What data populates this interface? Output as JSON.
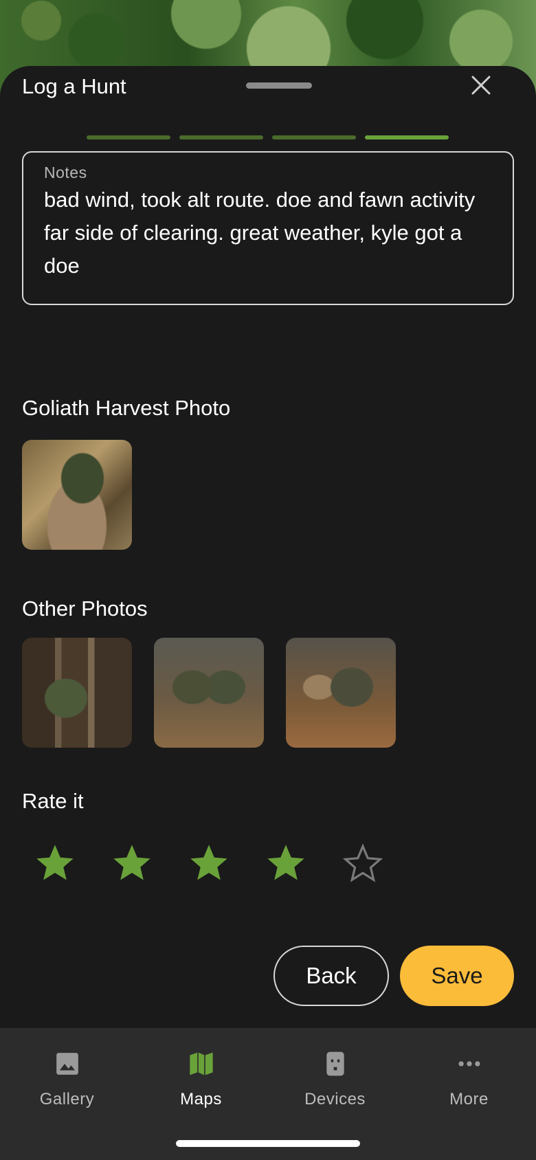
{
  "header": {
    "title": "Log a Hunt",
    "close_icon": "close-icon"
  },
  "progress": {
    "steps": 4,
    "current": 4
  },
  "notes": {
    "label": "Notes",
    "value": "bad wind, took alt route. doe and fawn activity far side of clearing. great weather, kyle got a doe"
  },
  "harvest": {
    "title": "Goliath Harvest Photo"
  },
  "other": {
    "title": "Other Photos"
  },
  "rating": {
    "title": "Rate it",
    "value": 4,
    "max": 5
  },
  "actions": {
    "back_label": "Back",
    "save_label": "Save"
  },
  "tabs": [
    {
      "label": "Gallery",
      "icon": "image-icon",
      "active": false
    },
    {
      "label": "Maps",
      "icon": "map-icon",
      "active": true
    },
    {
      "label": "Devices",
      "icon": "trail-camera-icon",
      "active": false
    },
    {
      "label": "More",
      "icon": "more-horizontal-icon",
      "active": false
    }
  ],
  "colors": {
    "accent_green": "#6aa23a",
    "save_yellow": "#fbbc3a",
    "background": "#1a1a1a",
    "tabbar": "#2c2c2c"
  }
}
